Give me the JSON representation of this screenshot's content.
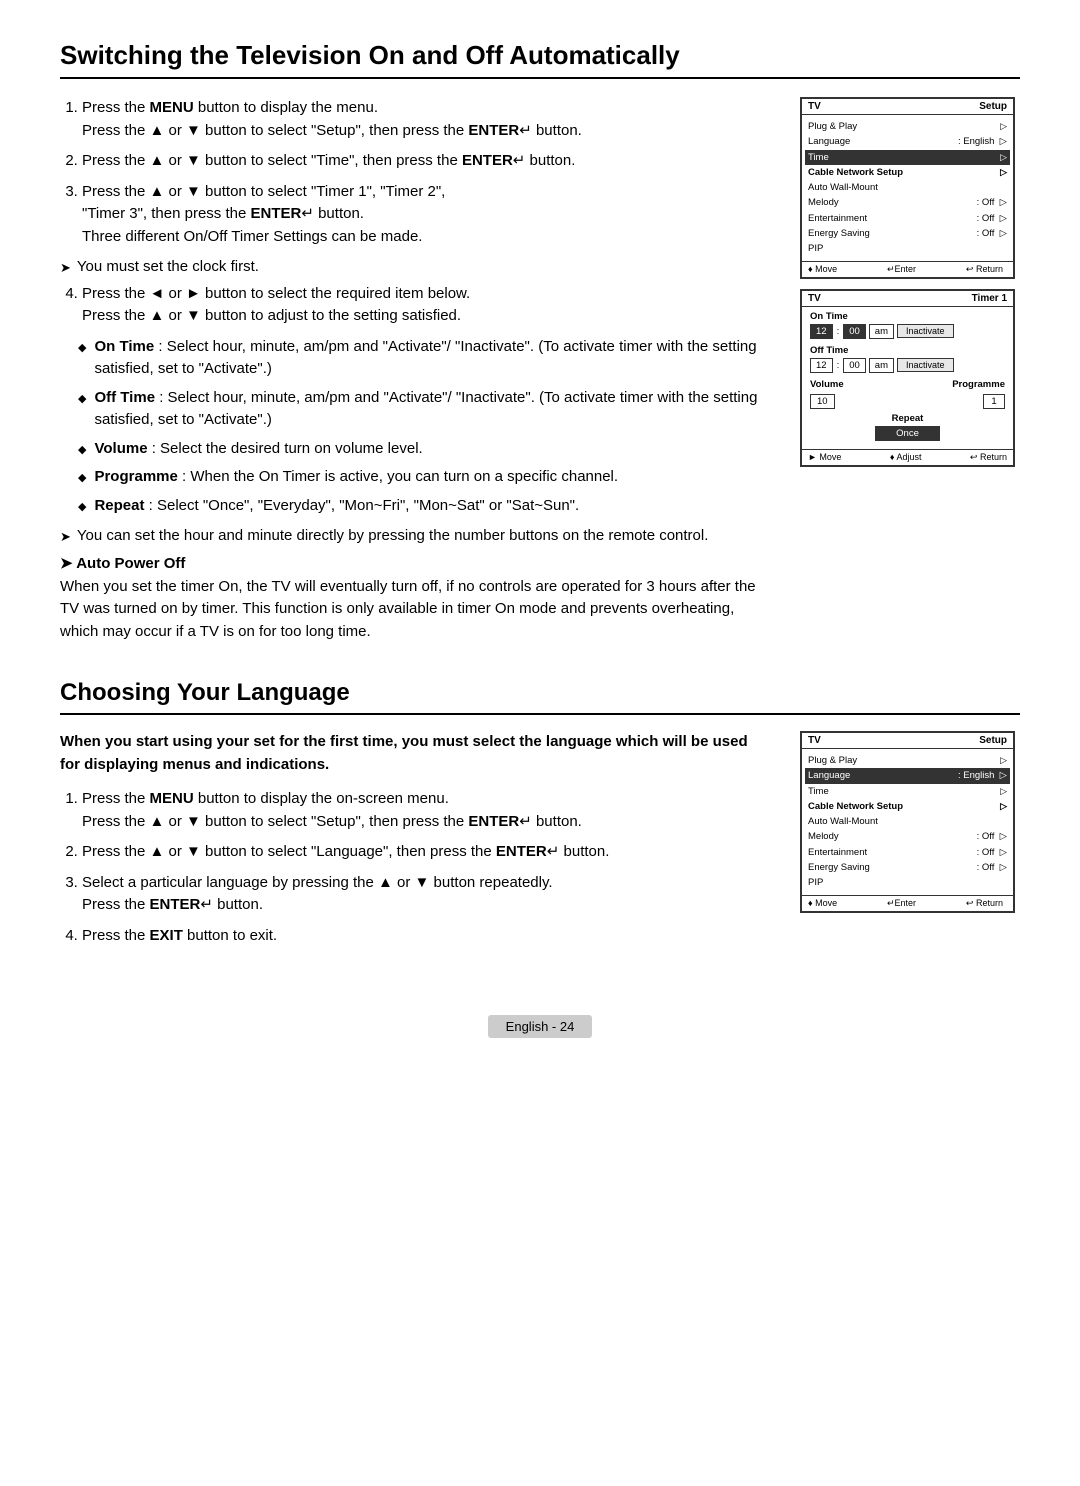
{
  "page": {
    "title1": "Switching the Television On and Off Automatically",
    "title2": "Choosing Your Language",
    "footer_label": "English - 24"
  },
  "section1": {
    "steps": [
      {
        "id": 1,
        "text_parts": [
          {
            "type": "text",
            "value": "Press the "
          },
          {
            "type": "bold",
            "value": "MENU"
          },
          {
            "type": "text",
            "value": " button to display the menu."
          },
          {
            "type": "br"
          },
          {
            "type": "text",
            "value": "Press the ▲ or ▼ button to select \"Setup\", then press the "
          },
          {
            "type": "bold",
            "value": "ENTER"
          },
          {
            "type": "text",
            "value": "↵ button."
          }
        ]
      },
      {
        "id": 2,
        "text_parts": [
          {
            "type": "text",
            "value": "Press the ▲ or ▼ button to select \"Time\", then press the "
          },
          {
            "type": "bold",
            "value": "ENTER"
          },
          {
            "type": "text",
            "value": "↵ button."
          }
        ]
      },
      {
        "id": 3,
        "text_parts": [
          {
            "type": "text",
            "value": "Press the ▲ or ▼ button to select \"Timer 1\", \"Timer 2\","
          },
          {
            "type": "br"
          },
          {
            "type": "text",
            "value": "\"Timer 3\", then press the "
          },
          {
            "type": "bold",
            "value": "ENTER"
          },
          {
            "type": "text",
            "value": "↵ button."
          },
          {
            "type": "br"
          },
          {
            "type": "text",
            "value": "Three different On/Off Timer Settings can be made."
          }
        ]
      }
    ],
    "arrow_item1": "You must set the clock first.",
    "step4": {
      "text_parts": [
        {
          "type": "text",
          "value": "Press the ◄ or ► button to select the required item below."
        },
        {
          "type": "br"
        },
        {
          "type": "text",
          "value": "Press the ▲ or ▼ button to adjust to the setting satisfied."
        }
      ]
    },
    "bullet1": {
      "bold": "On Time",
      "text": " : Select hour, minute, am/pm and \"Activate\"/ \"Inactivate\". (To activate timer with the setting satisfied, set to \"Activate\".)"
    },
    "bullet2": {
      "bold": "Off Time",
      "text": " : Select hour, minute, am/pm and \"Activate\"/ \"Inactivate\". (To activate timer with the setting satisfied, set to \"Activate\".)"
    },
    "bullet3": {
      "bold": "Volume",
      "text": " : Select the desired turn on volume level."
    },
    "bullet4": {
      "bold": "Programme",
      "text": " : When the On Timer is active, you can turn on a specific channel."
    },
    "bullet5": {
      "bold": "Repeat",
      "text": " : Select \"Once\", \"Everyday\", \"Mon~Fri\", \"Mon~Sat\" or \"Sat~Sun\"."
    },
    "arrow_item2": "You can set the hour and minute directly by pressing the number buttons on the remote control.",
    "auto_power_title": "Auto Power Off",
    "auto_power_text": "When you set the timer On, the TV will eventually turn off, if no controls are operated for 3 hours after the TV was turned on by timer. This function is only available in timer On mode and prevents overheating, which may occur if a TV is on for too long time."
  },
  "section2": {
    "intro": "When you start using your set for the first time, you must select the language which will be used for displaying menus and indications.",
    "steps": [
      {
        "id": 1,
        "text_parts": [
          {
            "type": "text",
            "value": "Press the "
          },
          {
            "type": "bold",
            "value": "MENU"
          },
          {
            "type": "text",
            "value": " button to display the on-screen menu."
          },
          {
            "type": "br"
          },
          {
            "type": "text",
            "value": "Press the ▲ or ▼ button to select \"Setup\", then press the "
          },
          {
            "type": "bold",
            "value": "ENTER"
          },
          {
            "type": "text",
            "value": "↵ button."
          }
        ]
      },
      {
        "id": 2,
        "text_parts": [
          {
            "type": "text",
            "value": "Press the ▲ or ▼ button to select \"Language\", then press the "
          },
          {
            "type": "bold",
            "value": "ENTER"
          },
          {
            "type": "text",
            "value": "↵ button."
          }
        ]
      },
      {
        "id": 3,
        "text_parts": [
          {
            "type": "text",
            "value": "Select a particular language by pressing the ▲ or ▼ button repeatedly."
          },
          {
            "type": "br"
          },
          {
            "type": "text",
            "value": "Press the "
          },
          {
            "type": "bold",
            "value": "ENTER"
          },
          {
            "type": "text",
            "value": "↵ button."
          }
        ]
      },
      {
        "id": 4,
        "text_parts": [
          {
            "type": "text",
            "value": "Press the "
          },
          {
            "type": "bold",
            "value": "EXIT"
          },
          {
            "type": "text",
            "value": " button to exit."
          }
        ]
      }
    ]
  },
  "tv_screen1": {
    "left_label": "TV",
    "right_label": "Setup",
    "rows": [
      {
        "label": "Plug & Play",
        "value": "",
        "arrow": true,
        "highlight": false,
        "bold_label": false
      },
      {
        "label": "Language",
        "value": ": English",
        "arrow": true,
        "highlight": false,
        "bold_label": false
      },
      {
        "label": "Time",
        "value": "",
        "arrow": true,
        "highlight": true,
        "bold_label": false
      },
      {
        "label": "Cable Network Setup",
        "value": "",
        "arrow": true,
        "highlight": false,
        "bold_label": true
      },
      {
        "label": "Auto Wall-Mount",
        "value": "",
        "arrow": false,
        "highlight": false,
        "bold_label": false
      },
      {
        "label": "Melody",
        "value": ": Off",
        "arrow": true,
        "highlight": false,
        "bold_label": false
      },
      {
        "label": "Entertainment",
        "value": ": Off",
        "arrow": true,
        "highlight": false,
        "bold_label": false
      },
      {
        "label": "Energy Saving",
        "value": ": Off",
        "arrow": true,
        "highlight": false,
        "bold_label": false
      },
      {
        "label": "PIP",
        "value": "",
        "arrow": false,
        "highlight": false,
        "bold_label": false
      }
    ],
    "footer": {
      "move": "♦ Move",
      "enter": "↵Enter",
      "return": "↩ Return"
    }
  },
  "timer_screen": {
    "left_label": "TV",
    "right_label": "Timer 1",
    "on_time_label": "On Time",
    "on_h": "12",
    "on_m": "00",
    "on_ampm": "am",
    "on_btn": "Inactivate",
    "off_time_label": "Off Time",
    "off_h": "12",
    "off_m": "00",
    "off_ampm": "am",
    "off_btn": "Inactivate",
    "volume_label": "Volume",
    "programme_label": "Programme",
    "volume_val": "10",
    "programme_val": "1",
    "repeat_label": "Repeat",
    "repeat_val": "Once",
    "footer": {
      "move": "► Move",
      "adjust": "♦ Adjust",
      "return": "↩ Return"
    }
  },
  "tv_screen2": {
    "left_label": "TV",
    "right_label": "Setup",
    "rows": [
      {
        "label": "Plug & Play",
        "value": "",
        "arrow": true,
        "highlight": false,
        "bold_label": false
      },
      {
        "label": "Language",
        "value": ": English",
        "arrow": true,
        "highlight": true,
        "bold_label": false
      },
      {
        "label": "Time",
        "value": "",
        "arrow": true,
        "highlight": false,
        "bold_label": false
      },
      {
        "label": "Cable Network Setup",
        "value": "",
        "arrow": true,
        "highlight": false,
        "bold_label": true
      },
      {
        "label": "Auto Wall-Mount",
        "value": "",
        "arrow": false,
        "highlight": false,
        "bold_label": false
      },
      {
        "label": "Melody",
        "value": ": Off",
        "arrow": true,
        "highlight": false,
        "bold_label": false
      },
      {
        "label": "Entertainment",
        "value": ": Off",
        "arrow": true,
        "highlight": false,
        "bold_label": false
      },
      {
        "label": "Energy Saving",
        "value": ": Off",
        "arrow": true,
        "highlight": false,
        "bold_label": false
      },
      {
        "label": "PIP",
        "value": "",
        "arrow": false,
        "highlight": false,
        "bold_label": false
      }
    ],
    "footer": {
      "move": "♦ Move",
      "enter": "↵Enter",
      "return": "↩ Return"
    }
  }
}
